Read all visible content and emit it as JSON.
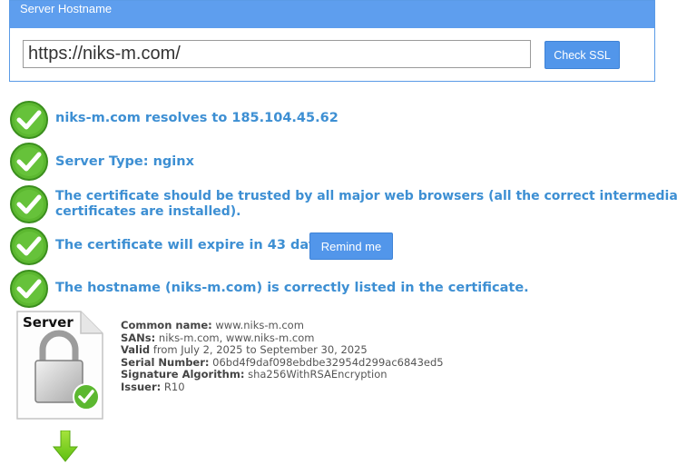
{
  "header": {
    "title": "Server Hostname",
    "url_value": "https://niks-m.com/",
    "check_button": "Check SSL"
  },
  "checks": [
    {
      "text": "niks-m.com resolves to 185.104.45.62",
      "status": "ok"
    },
    {
      "text": "Server Type: nginx",
      "status": "ok"
    },
    {
      "line1": "The certificate should be trusted by all major web browsers (all the correct intermediate",
      "line2": "certificates are installed).",
      "status": "ok"
    },
    {
      "text": "The certificate will expire in 43 days.",
      "status": "ok",
      "button": "Remind me"
    },
    {
      "text": "The hostname (niks-m.com) is correctly listed in the certificate.",
      "status": "ok"
    }
  ],
  "certificate": {
    "icon_label": "Server",
    "common_name_label": "Common name:",
    "common_name": "www.niks-m.com",
    "sans_label": "SANs:",
    "sans": "niks-m.com, www.niks-m.com",
    "valid_label": "Valid",
    "valid": "from July 2, 2025 to September 30, 2025",
    "serial_label": "Serial Number:",
    "serial": "06bd4f9daf098ebdbe32954d299ac6843ed5",
    "sig_label": "Signature Algorithm:",
    "sig": "sha256WithRSAEncryption",
    "issuer_label": "Issuer:",
    "issuer": "R10"
  },
  "colors": {
    "header_blue": "#5e9eee",
    "check_green": "#5cb830",
    "text_blue": "#3d8fd3",
    "arrow_green": "#7fd11b"
  }
}
